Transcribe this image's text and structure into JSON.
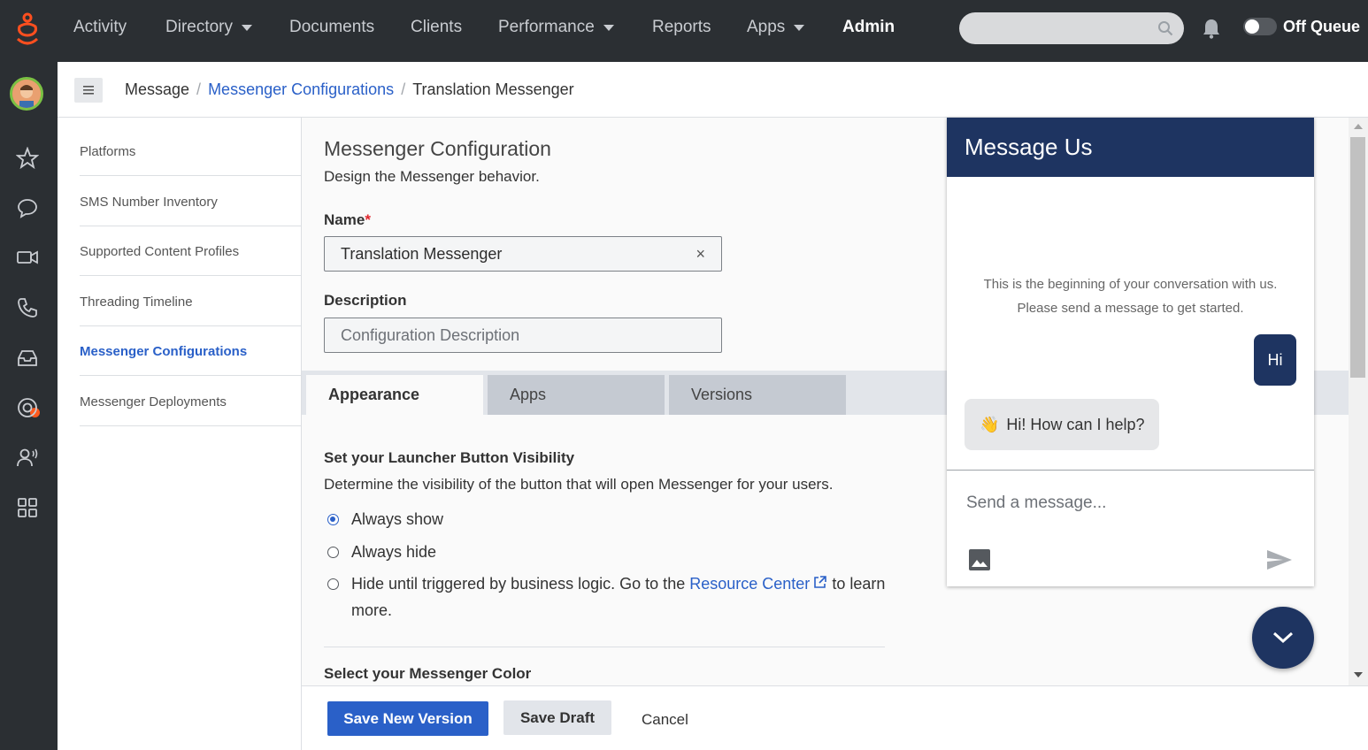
{
  "nav": {
    "items": [
      {
        "label": "Activity",
        "dropdown": false
      },
      {
        "label": "Directory",
        "dropdown": true
      },
      {
        "label": "Documents",
        "dropdown": false
      },
      {
        "label": "Clients",
        "dropdown": false
      },
      {
        "label": "Performance",
        "dropdown": true
      },
      {
        "label": "Reports",
        "dropdown": false
      },
      {
        "label": "Apps",
        "dropdown": true
      },
      {
        "label": "Admin",
        "dropdown": false,
        "active": true
      }
    ],
    "search_placeholder": "",
    "queue_status": "Off Queue",
    "brand_color": "#ff4f1f"
  },
  "rail": {
    "icons": [
      "favorites-icon",
      "chat-icon",
      "video-icon",
      "phone-icon",
      "inbox-icon",
      "support-icon",
      "voice-user-icon",
      "apps-grid-icon"
    ]
  },
  "breadcrumb": {
    "items": [
      "Message",
      "Messenger Configurations",
      "Translation Messenger"
    ]
  },
  "sidebar": {
    "items": [
      {
        "label": "Platforms"
      },
      {
        "label": "SMS Number Inventory"
      },
      {
        "label": "Supported Content Profiles"
      },
      {
        "label": "Threading Timeline"
      },
      {
        "label": "Messenger Configurations",
        "active": true
      },
      {
        "label": "Messenger Deployments"
      }
    ]
  },
  "form": {
    "title": "Messenger Configuration",
    "subtitle": "Design the Messenger behavior.",
    "name_label": "Name",
    "required_marker": "*",
    "name_value": "Translation Messenger",
    "clear_glyph": "×",
    "description_label": "Description",
    "description_placeholder": "Configuration Description",
    "tabs": [
      "Appearance",
      "Apps",
      "Versions"
    ],
    "active_tab": "Appearance",
    "launcher_title": "Set your Launcher Button Visibility",
    "launcher_desc": "Determine the visibility of the button that will open Messenger for your users.",
    "launcher_options": {
      "always_show": "Always show",
      "always_hide": "Always hide",
      "hide_prefix": "Hide until triggered by business logic. Go to the",
      "hide_link": "Resource Center",
      "hide_suffix": "to learn",
      "hide_suffix2": "more."
    },
    "selected_option": "Always show",
    "color_title": "Select your Messenger Color"
  },
  "messenger": {
    "header": "Message Us",
    "intro_line1": "This is the beginning of your conversation with us.",
    "intro_line2": "Please send a message to get started.",
    "user_message": "Hi",
    "bot_emoji": "👋",
    "bot_message": "Hi! How can I help?",
    "input_placeholder": "Send a message...",
    "theme_color": "#1e3461"
  },
  "footer": {
    "save_version": "Save New Version",
    "save_draft": "Save Draft",
    "cancel": "Cancel"
  }
}
